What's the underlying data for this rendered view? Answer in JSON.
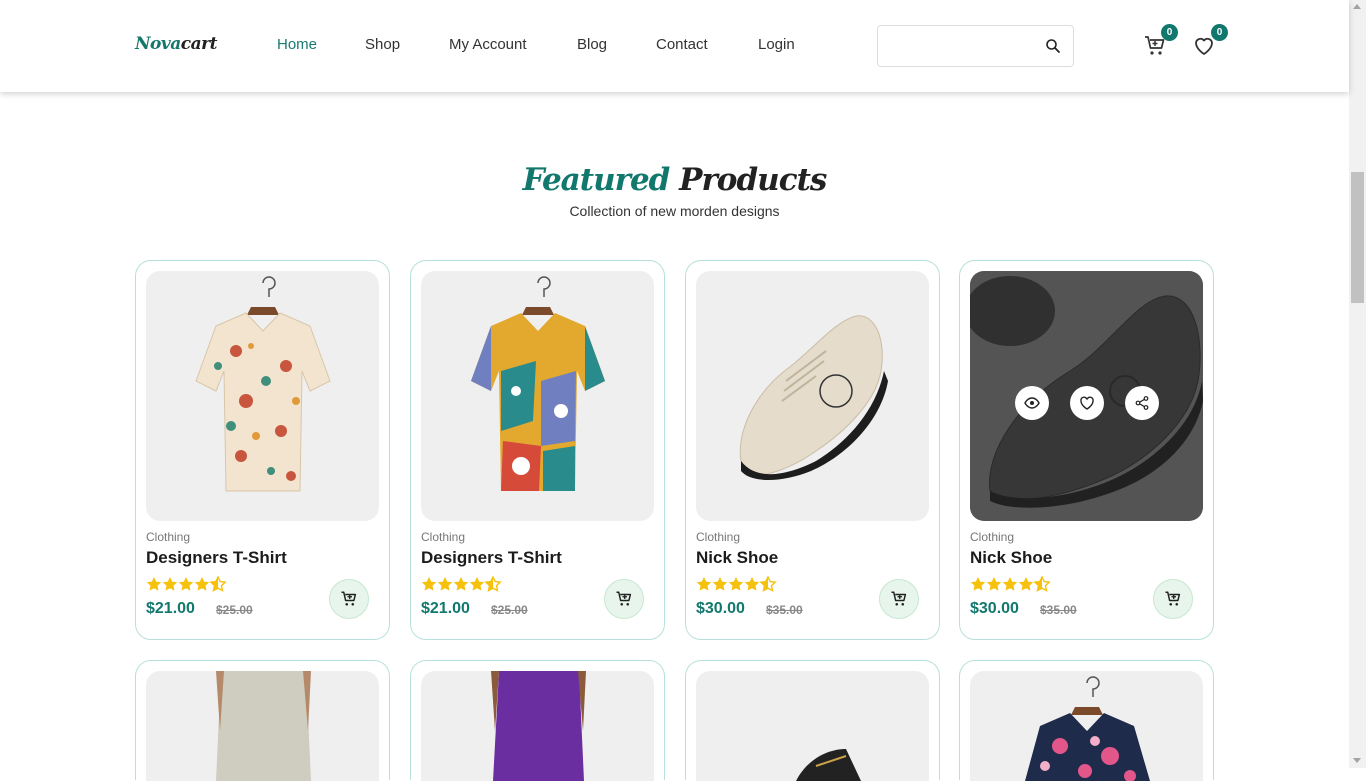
{
  "brand": {
    "part1": "Nova",
    "part2": "cart"
  },
  "nav": [
    {
      "label": "Home",
      "active": true
    },
    {
      "label": "Shop",
      "active": false
    },
    {
      "label": "My Account",
      "active": false
    },
    {
      "label": "Blog",
      "active": false
    },
    {
      "label": "Contact",
      "active": false
    },
    {
      "label": "Login",
      "active": false
    }
  ],
  "search": {
    "placeholder": "",
    "icon": "search-icon"
  },
  "cart": {
    "icon": "cart-icon",
    "count": "0"
  },
  "wishlist": {
    "icon": "heart-icon",
    "count": "0"
  },
  "section": {
    "title_part1": "Featured",
    "title_part2": "Products",
    "subtitle": "Collection of new morden designs"
  },
  "colors": {
    "accent": "#12786d",
    "star": "#f4c20d",
    "card_border": "#b8e0da"
  },
  "products": [
    {
      "category": "Clothing",
      "name": "Designers T-Shirt",
      "price": "$21.00",
      "old_price": "$25.00",
      "rating": 4.5,
      "image": "mushroom-print-shirt"
    },
    {
      "category": "Clothing",
      "name": "Designers T-Shirt",
      "price": "$21.00",
      "old_price": "$25.00",
      "rating": 4.5,
      "image": "floral-print-shirt"
    },
    {
      "category": "Clothing",
      "name": "Nick Shoe",
      "price": "$30.00",
      "old_price": "$35.00",
      "rating": 4.5,
      "image": "beige-shoe"
    },
    {
      "category": "Clothing",
      "name": "Nick Shoe",
      "price": "$30.00",
      "old_price": "$35.00",
      "rating": 4.5,
      "image": "grey-shoe",
      "hover_actions": [
        "eye-icon",
        "heart-icon",
        "share-icon"
      ]
    }
  ],
  "products_row2": [
    {
      "image": "beige-linen-pants"
    },
    {
      "image": "purple-pants"
    },
    {
      "image": "dark-shoe"
    },
    {
      "image": "pink-floral-shirt"
    }
  ]
}
